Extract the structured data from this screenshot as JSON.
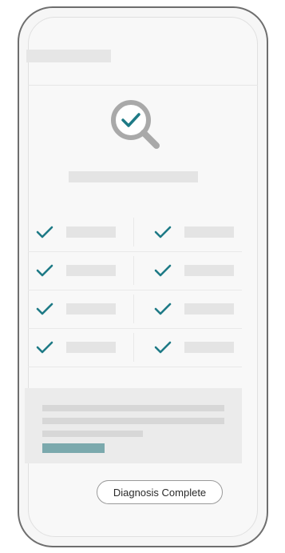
{
  "colors": {
    "accent": "#1e7a86",
    "placeholder": "#e4e4e4",
    "progress_accent": "#7ba9ad",
    "frame": "#6e6e6e"
  },
  "icons": {
    "magnifier": "search-magnifier-with-check-icon",
    "check": "check-icon"
  },
  "checklist": {
    "rows": 4,
    "columns": 2,
    "all_checked": true
  },
  "status": {
    "label": "Diagnosis Complete"
  }
}
